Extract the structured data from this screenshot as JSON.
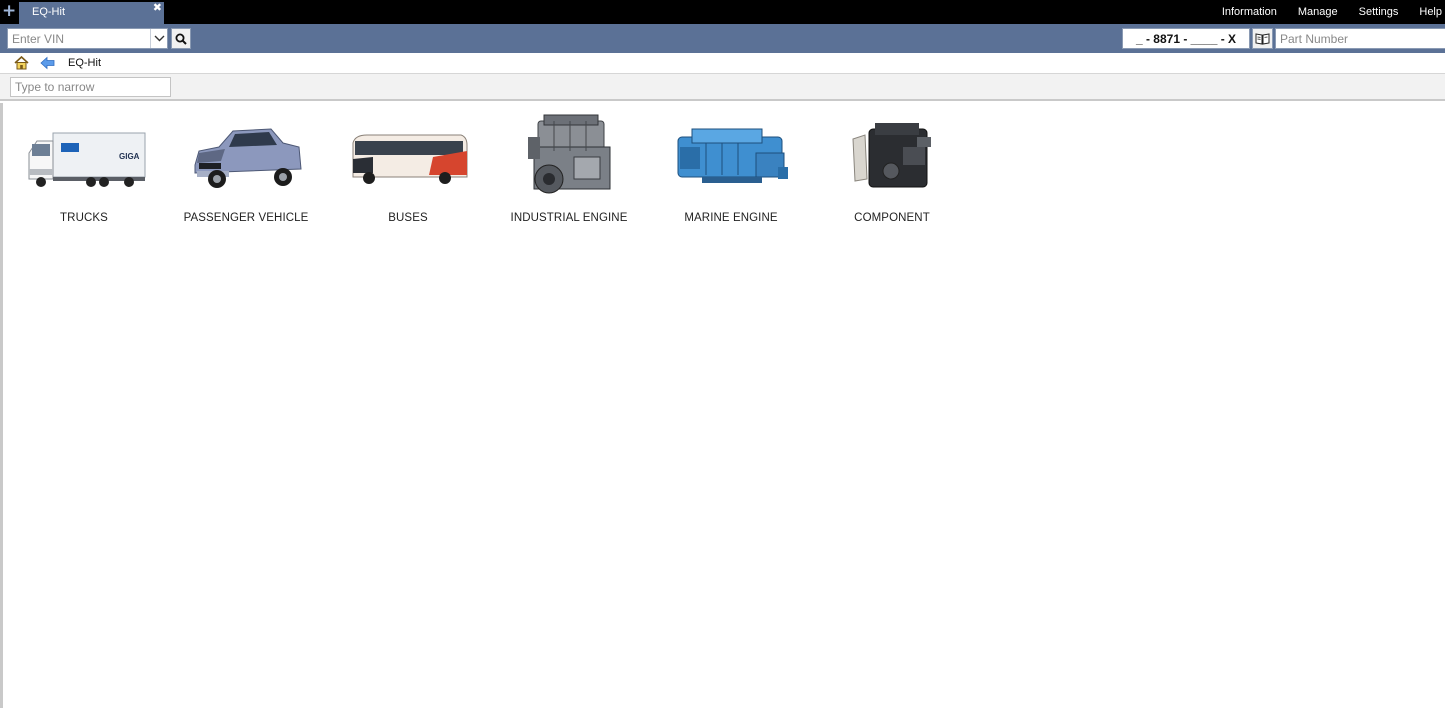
{
  "topbar": {
    "new_tab_icon": "plus-icon",
    "tab": {
      "label": "EQ-Hit",
      "close_icon": "close-icon"
    },
    "menu": [
      "Information",
      "Manage",
      "Settings",
      "Help"
    ]
  },
  "searchbar": {
    "vin_placeholder": "Enter VIN",
    "dropdown_icon": "chevron-down-icon",
    "search_icon": "search-icon",
    "part_code": "_ - 8871 - ____ - X",
    "book_icon": "book-icon",
    "part_number_placeholder": "Part Number"
  },
  "breadcrumb": {
    "home_icon": "home-icon",
    "back_icon": "back-arrow-icon",
    "current": "EQ-Hit"
  },
  "filter": {
    "placeholder": "Type to narrow"
  },
  "categories": [
    {
      "label": "TRUCKS",
      "icon": "truck-image"
    },
    {
      "label": "PASSENGER VEHICLE",
      "icon": "pickup-image"
    },
    {
      "label": "BUSES",
      "icon": "bus-image"
    },
    {
      "label": "INDUSTRIAL ENGINE",
      "icon": "industrial-engine-image"
    },
    {
      "label": "MARINE ENGINE",
      "icon": "marine-engine-image"
    },
    {
      "label": "COMPONENT",
      "icon": "component-image"
    }
  ],
  "colors": {
    "topbar": "#000000",
    "accent_blue": "#5b7196",
    "marine_blue": "#3f8fd0"
  }
}
